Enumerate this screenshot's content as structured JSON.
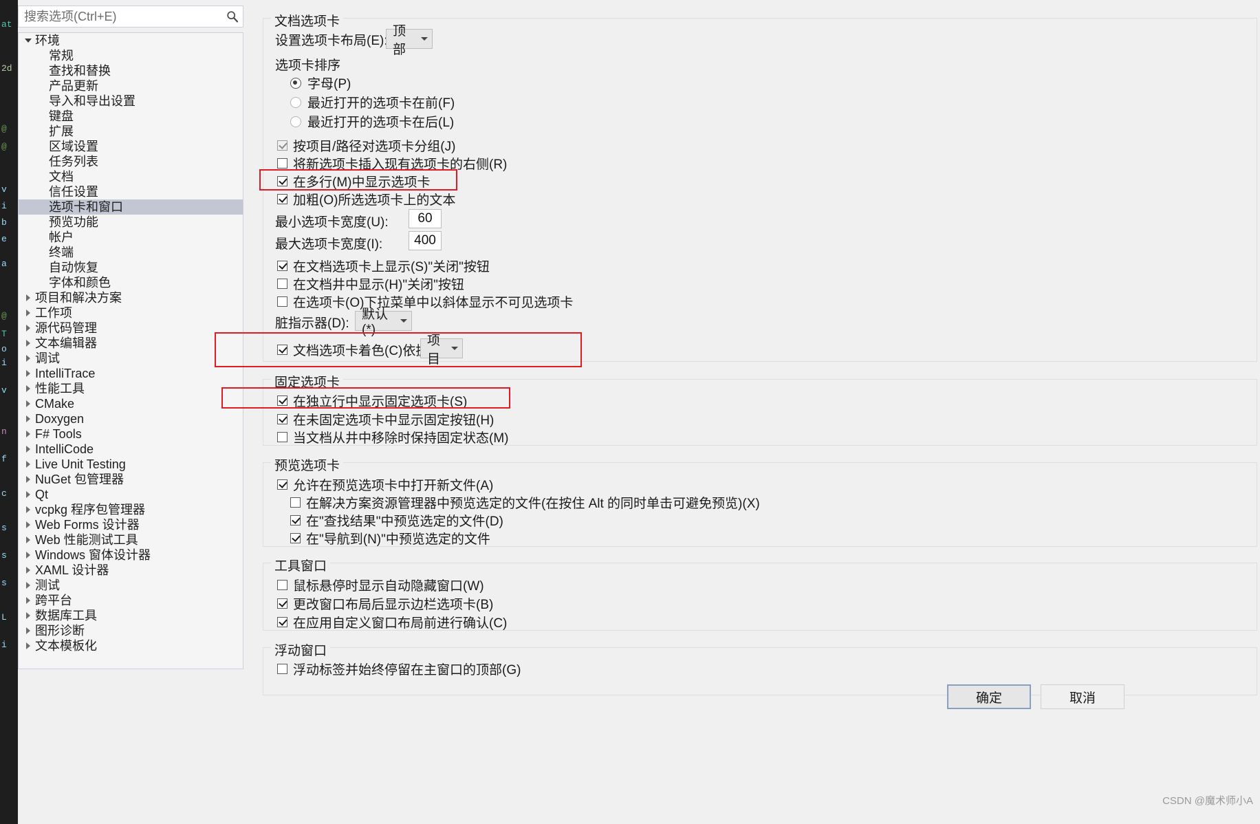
{
  "search": {
    "placeholder": "搜索选项(Ctrl+E)",
    "value": "",
    "icon": "search-icon"
  },
  "tree": {
    "items": [
      {
        "label": "环境",
        "level": 0,
        "expander": "down",
        "selected": false
      },
      {
        "label": "常规",
        "level": 1,
        "expander": "none",
        "selected": false
      },
      {
        "label": "查找和替换",
        "level": 1,
        "expander": "none",
        "selected": false
      },
      {
        "label": "产品更新",
        "level": 1,
        "expander": "none",
        "selected": false
      },
      {
        "label": "导入和导出设置",
        "level": 1,
        "expander": "none",
        "selected": false
      },
      {
        "label": "键盘",
        "level": 1,
        "expander": "none",
        "selected": false
      },
      {
        "label": "扩展",
        "level": 1,
        "expander": "none",
        "selected": false
      },
      {
        "label": "区域设置",
        "level": 1,
        "expander": "none",
        "selected": false
      },
      {
        "label": "任务列表",
        "level": 1,
        "expander": "none",
        "selected": false
      },
      {
        "label": "文档",
        "level": 1,
        "expander": "none",
        "selected": false
      },
      {
        "label": "信任设置",
        "level": 1,
        "expander": "none",
        "selected": false
      },
      {
        "label": "选项卡和窗口",
        "level": 1,
        "expander": "none",
        "selected": true
      },
      {
        "label": "预览功能",
        "level": 1,
        "expander": "none",
        "selected": false
      },
      {
        "label": "帐户",
        "level": 1,
        "expander": "none",
        "selected": false
      },
      {
        "label": "终端",
        "level": 1,
        "expander": "none",
        "selected": false
      },
      {
        "label": "自动恢复",
        "level": 1,
        "expander": "none",
        "selected": false
      },
      {
        "label": "字体和颜色",
        "level": 1,
        "expander": "none",
        "selected": false
      },
      {
        "label": "项目和解决方案",
        "level": 0,
        "expander": "right",
        "selected": false
      },
      {
        "label": "工作项",
        "level": 0,
        "expander": "right",
        "selected": false
      },
      {
        "label": "源代码管理",
        "level": 0,
        "expander": "right",
        "selected": false
      },
      {
        "label": "文本编辑器",
        "level": 0,
        "expander": "right",
        "selected": false
      },
      {
        "label": "调试",
        "level": 0,
        "expander": "right",
        "selected": false
      },
      {
        "label": "IntelliTrace",
        "level": 0,
        "expander": "right",
        "selected": false
      },
      {
        "label": "性能工具",
        "level": 0,
        "expander": "right",
        "selected": false
      },
      {
        "label": "CMake",
        "level": 0,
        "expander": "right",
        "selected": false
      },
      {
        "label": "Doxygen",
        "level": 0,
        "expander": "right",
        "selected": false
      },
      {
        "label": "F# Tools",
        "level": 0,
        "expander": "right",
        "selected": false
      },
      {
        "label": "IntelliCode",
        "level": 0,
        "expander": "right",
        "selected": false
      },
      {
        "label": "Live Unit Testing",
        "level": 0,
        "expander": "right",
        "selected": false
      },
      {
        "label": "NuGet 包管理器",
        "level": 0,
        "expander": "right",
        "selected": false
      },
      {
        "label": "Qt",
        "level": 0,
        "expander": "right",
        "selected": false
      },
      {
        "label": "vcpkg 程序包管理器",
        "level": 0,
        "expander": "right",
        "selected": false
      },
      {
        "label": "Web Forms 设计器",
        "level": 0,
        "expander": "right",
        "selected": false
      },
      {
        "label": "Web 性能测试工具",
        "level": 0,
        "expander": "right",
        "selected": false
      },
      {
        "label": "Windows 窗体设计器",
        "level": 0,
        "expander": "right",
        "selected": false
      },
      {
        "label": "XAML 设计器",
        "level": 0,
        "expander": "right",
        "selected": false
      },
      {
        "label": "测试",
        "level": 0,
        "expander": "right",
        "selected": false
      },
      {
        "label": "跨平台",
        "level": 0,
        "expander": "right",
        "selected": false
      },
      {
        "label": "数据库工具",
        "level": 0,
        "expander": "right",
        "selected": false
      },
      {
        "label": "图形诊断",
        "level": 0,
        "expander": "right",
        "selected": false
      },
      {
        "label": "文本模板化",
        "level": 0,
        "expander": "right",
        "selected": false
      }
    ]
  },
  "document_tabs": {
    "group_title": "文档选项卡",
    "layout_label": "设置选项卡布局(E):",
    "layout_value": "顶部",
    "ordering_label": "选项卡排序",
    "radios": [
      {
        "label": "字母(P)",
        "checked": true
      },
      {
        "label": "最近打开的选项卡在前(F)",
        "checked": false
      },
      {
        "label": "最近打开的选项卡在后(L)",
        "checked": false
      }
    ],
    "checks": [
      {
        "label": "按项目/路径对选项卡分组(J)",
        "checked": true,
        "disabled": true
      },
      {
        "label": "将新选项卡插入现有选项卡的右侧(R)",
        "checked": false,
        "disabled": false
      },
      {
        "label": "在多行(M)中显示选项卡",
        "checked": true,
        "disabled": false
      },
      {
        "label": "加粗(O)所选选项卡上的文本",
        "checked": true,
        "disabled": false
      }
    ],
    "min_width_label": "最小选项卡宽度(U):",
    "min_width_value": "60",
    "max_width_label": "最大选项卡宽度(I):",
    "max_width_value": "400",
    "checks2": [
      {
        "label": "在文档选项卡上显示(S)\"关闭\"按钮",
        "checked": true,
        "disabled": false
      },
      {
        "label": "在文档井中显示(H)\"关闭\"按钮",
        "checked": false,
        "disabled": false
      },
      {
        "label": "在选项卡(O)下拉菜单中以斜体显示不可见选项卡",
        "checked": false,
        "disabled": false
      }
    ],
    "dirty_label": "脏指示器(D):",
    "dirty_value": "默认(*)",
    "coloring_label": "文档选项卡着色(C)依据:",
    "coloring_checked": true,
    "coloring_value": "项目"
  },
  "pinned_tabs": {
    "group_title": "固定选项卡",
    "checks": [
      {
        "label": "在独立行中显示固定选项卡(S)",
        "checked": true
      },
      {
        "label": "在未固定选项卡中显示固定按钮(H)",
        "checked": true
      },
      {
        "label": "当文档从井中移除时保持固定状态(M)",
        "checked": false
      }
    ]
  },
  "preview_tabs": {
    "group_title": "预览选项卡",
    "checks": [
      {
        "label": "允许在预览选项卡中打开新文件(A)",
        "checked": true,
        "indent": 0
      },
      {
        "label": "在解决方案资源管理器中预览选定的文件(在按住 Alt 的同时单击可避免预览)(X)",
        "checked": false,
        "indent": 1
      },
      {
        "label": "在\"查找结果\"中预览选定的文件(D)",
        "checked": true,
        "indent": 1
      },
      {
        "label": "在\"导航到(N)\"中预览选定的文件",
        "checked": true,
        "indent": 1
      }
    ]
  },
  "tool_windows": {
    "group_title": "工具窗口",
    "checks": [
      {
        "label": "鼠标悬停时显示自动隐藏窗口(W)",
        "checked": false
      },
      {
        "label": "更改窗口布局后显示边栏选项卡(B)",
        "checked": true
      },
      {
        "label": "在应用自定义窗口布局前进行确认(C)",
        "checked": true
      }
    ]
  },
  "floating_windows": {
    "group_title": "浮动窗口",
    "checks": [
      {
        "label": "浮动标签并始终停留在主窗口的顶部(G)",
        "checked": false
      }
    ]
  },
  "buttons": {
    "ok": "确定",
    "cancel": "取消"
  },
  "annotations": {
    "color": "#e01b24",
    "count": 3
  },
  "watermark": "CSDN @魔术师小A",
  "background_code": [
    "at",
    "2d",
    "@",
    "@",
    "v",
    "i",
    "b",
    "e",
    "a",
    "@",
    "T",
    "o",
    "i",
    "v",
    "n",
    "f",
    "c",
    "s",
    "s",
    "s",
    "L",
    "i"
  ]
}
